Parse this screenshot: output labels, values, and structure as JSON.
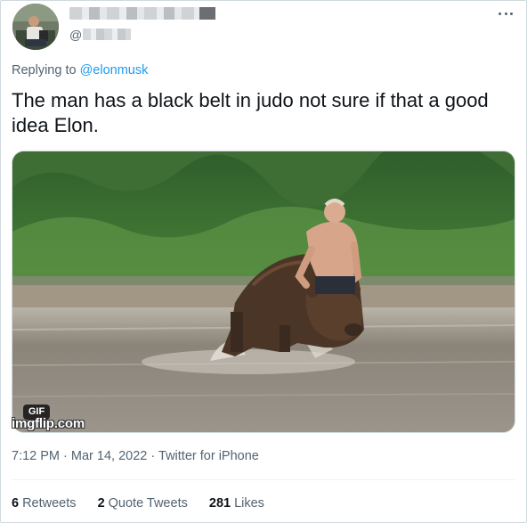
{
  "author": {
    "handle_prefix": "@",
    "avatar_icon": "profile-photo-icon"
  },
  "replying": {
    "prefix": "Replying to",
    "mention": "@elonmusk"
  },
  "tweet": {
    "text": "The man has a black belt in judo not sure if that a good idea Elon."
  },
  "media": {
    "badge": "GIF",
    "watermark": "imgflip.com"
  },
  "meta": {
    "time": "7:12 PM",
    "separator": "·",
    "date": "Mar 14, 2022",
    "source": "Twitter for iPhone"
  },
  "stats": {
    "retweets_count": "6",
    "retweets_label": "Retweets",
    "quotes_count": "2",
    "quotes_label": "Quote Tweets",
    "likes_count": "281",
    "likes_label": "Likes"
  },
  "colors": {
    "link": "#1d9bf0",
    "secondary_text": "#536471",
    "primary_text": "#0f1419",
    "border": "#cfd9de"
  }
}
